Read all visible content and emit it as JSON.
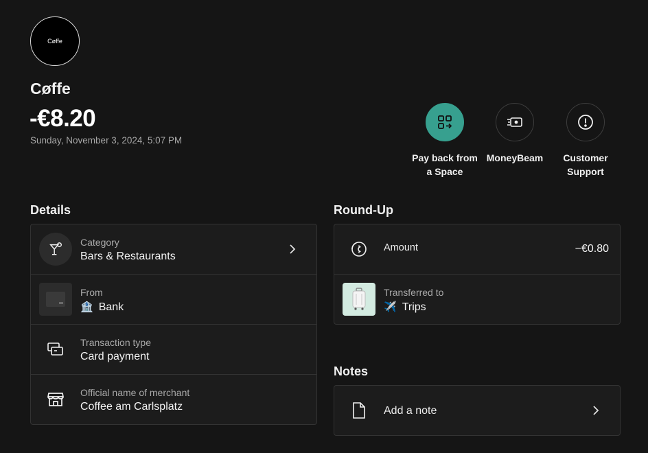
{
  "merchant": {
    "logo_text": "Cøffe",
    "name": "Cøffe",
    "amount": "-€8.20",
    "date": "Sunday, November 3, 2024, 5:07 PM"
  },
  "actions": [
    {
      "label": "Pay back from a Space",
      "icon": "pay-back-icon",
      "primary_color": "#37a08f"
    },
    {
      "label": "MoneyBeam",
      "icon": "money-beam-icon"
    },
    {
      "label": "Customer Support",
      "icon": "alert-circle-icon"
    }
  ],
  "details": {
    "title": "Details",
    "rows": [
      {
        "small": "Category",
        "main": "Bars & Restaurants",
        "icon": "cocktail-icon"
      },
      {
        "small": "From",
        "main": "Bank",
        "prefix_icon": "bank-emoji",
        "icon": "card-thumbnail"
      },
      {
        "small": "Transaction type",
        "main": "Card payment",
        "icon": "cards-icon"
      },
      {
        "small": "Official name of merchant",
        "main": "Coffee am Carlsplatz",
        "icon": "storefront-icon"
      }
    ]
  },
  "roundup": {
    "title": "Round-Up",
    "amount_label": "Amount",
    "amount_value": "−€0.80",
    "transferred_label": "Transferred to",
    "transferred_target": "Trips",
    "target_icon": "airplane-emoji"
  },
  "notes": {
    "title": "Notes",
    "add_label": "Add a note"
  },
  "colors": {
    "background": "#151515",
    "card": "#1c1c1c",
    "accent": "#37a08f",
    "muted_text": "#a9a9a9"
  }
}
